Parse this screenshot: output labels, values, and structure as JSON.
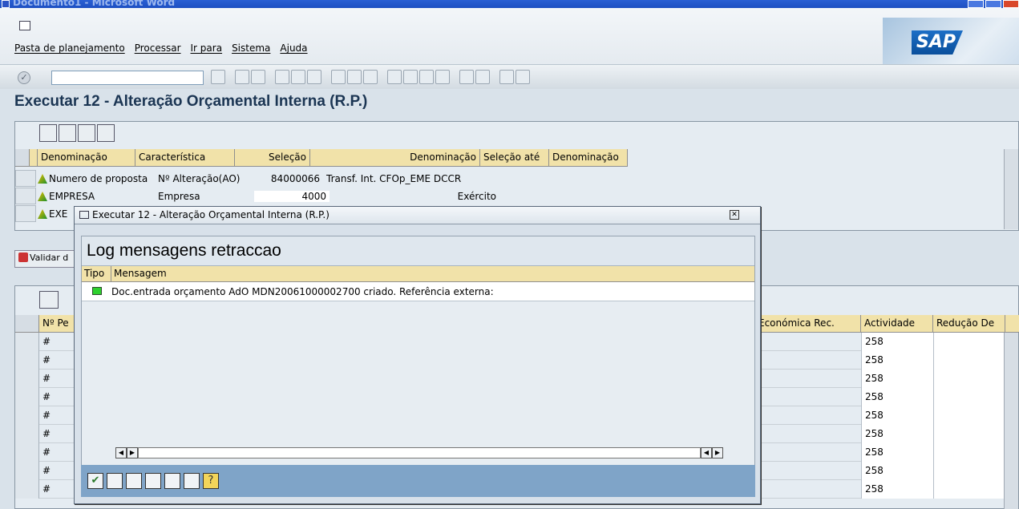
{
  "window": {
    "title": "Documento1 - Microsoft Word"
  },
  "menubar": [
    "Pasta de planejamento",
    "Processar",
    "Ir para",
    "Sistema",
    "Ajuda"
  ],
  "brand": {
    "logo": "SAP",
    "accent": "#1b3553"
  },
  "page_title": "Executar 12 - Alteração Orçamental Interna (R.P.)",
  "selection_grid": {
    "headers": [
      "Denominação",
      "Característica",
      "Seleção",
      "Denominação",
      "Seleção até",
      "Denominação"
    ],
    "rows": [
      {
        "denominacao": "Numero de proposta",
        "caracteristica": "Nº Alteração(AO)",
        "selecao": "84000066",
        "denominacao2": "Transf. Int. CFOp_EME DCCR"
      },
      {
        "denominacao": "EMPRESA",
        "caracteristica": "Empresa",
        "selecao": "4000",
        "denominacao2": "Exército"
      },
      {
        "denominacao": "EXE",
        "caracteristica": "",
        "selecao": "",
        "denominacao2": ""
      }
    ]
  },
  "validate_button": "Validar d",
  "lower_grid": {
    "headers": [
      "Nº Pe",
      "Económica Rec.",
      "Actividade",
      "Redução De"
    ],
    "rows": [
      {
        "hash": "#",
        "actividade": "258"
      },
      {
        "hash": "#",
        "actividade": "258"
      },
      {
        "hash": "#",
        "actividade": "258"
      },
      {
        "hash": "#",
        "actividade": "258"
      },
      {
        "hash": "#",
        "actividade": "258"
      },
      {
        "hash": "#",
        "actividade": "258"
      },
      {
        "hash": "#",
        "actividade": "258"
      },
      {
        "hash": "#",
        "actividade": "258"
      },
      {
        "hash": "#",
        "actividade": "258"
      }
    ]
  },
  "dialog": {
    "title": "Executar 12 - Alteração Orçamental Interna (R.P.)",
    "log_title": "Log mensagens retraccao",
    "headers": [
      "Tipo",
      "Mensagem"
    ],
    "messages": [
      {
        "status": "success",
        "color": "#2ed12e",
        "text": "Doc.entrada orçamento AdO MDN20061000002700 criado. Referência externa:"
      }
    ]
  }
}
